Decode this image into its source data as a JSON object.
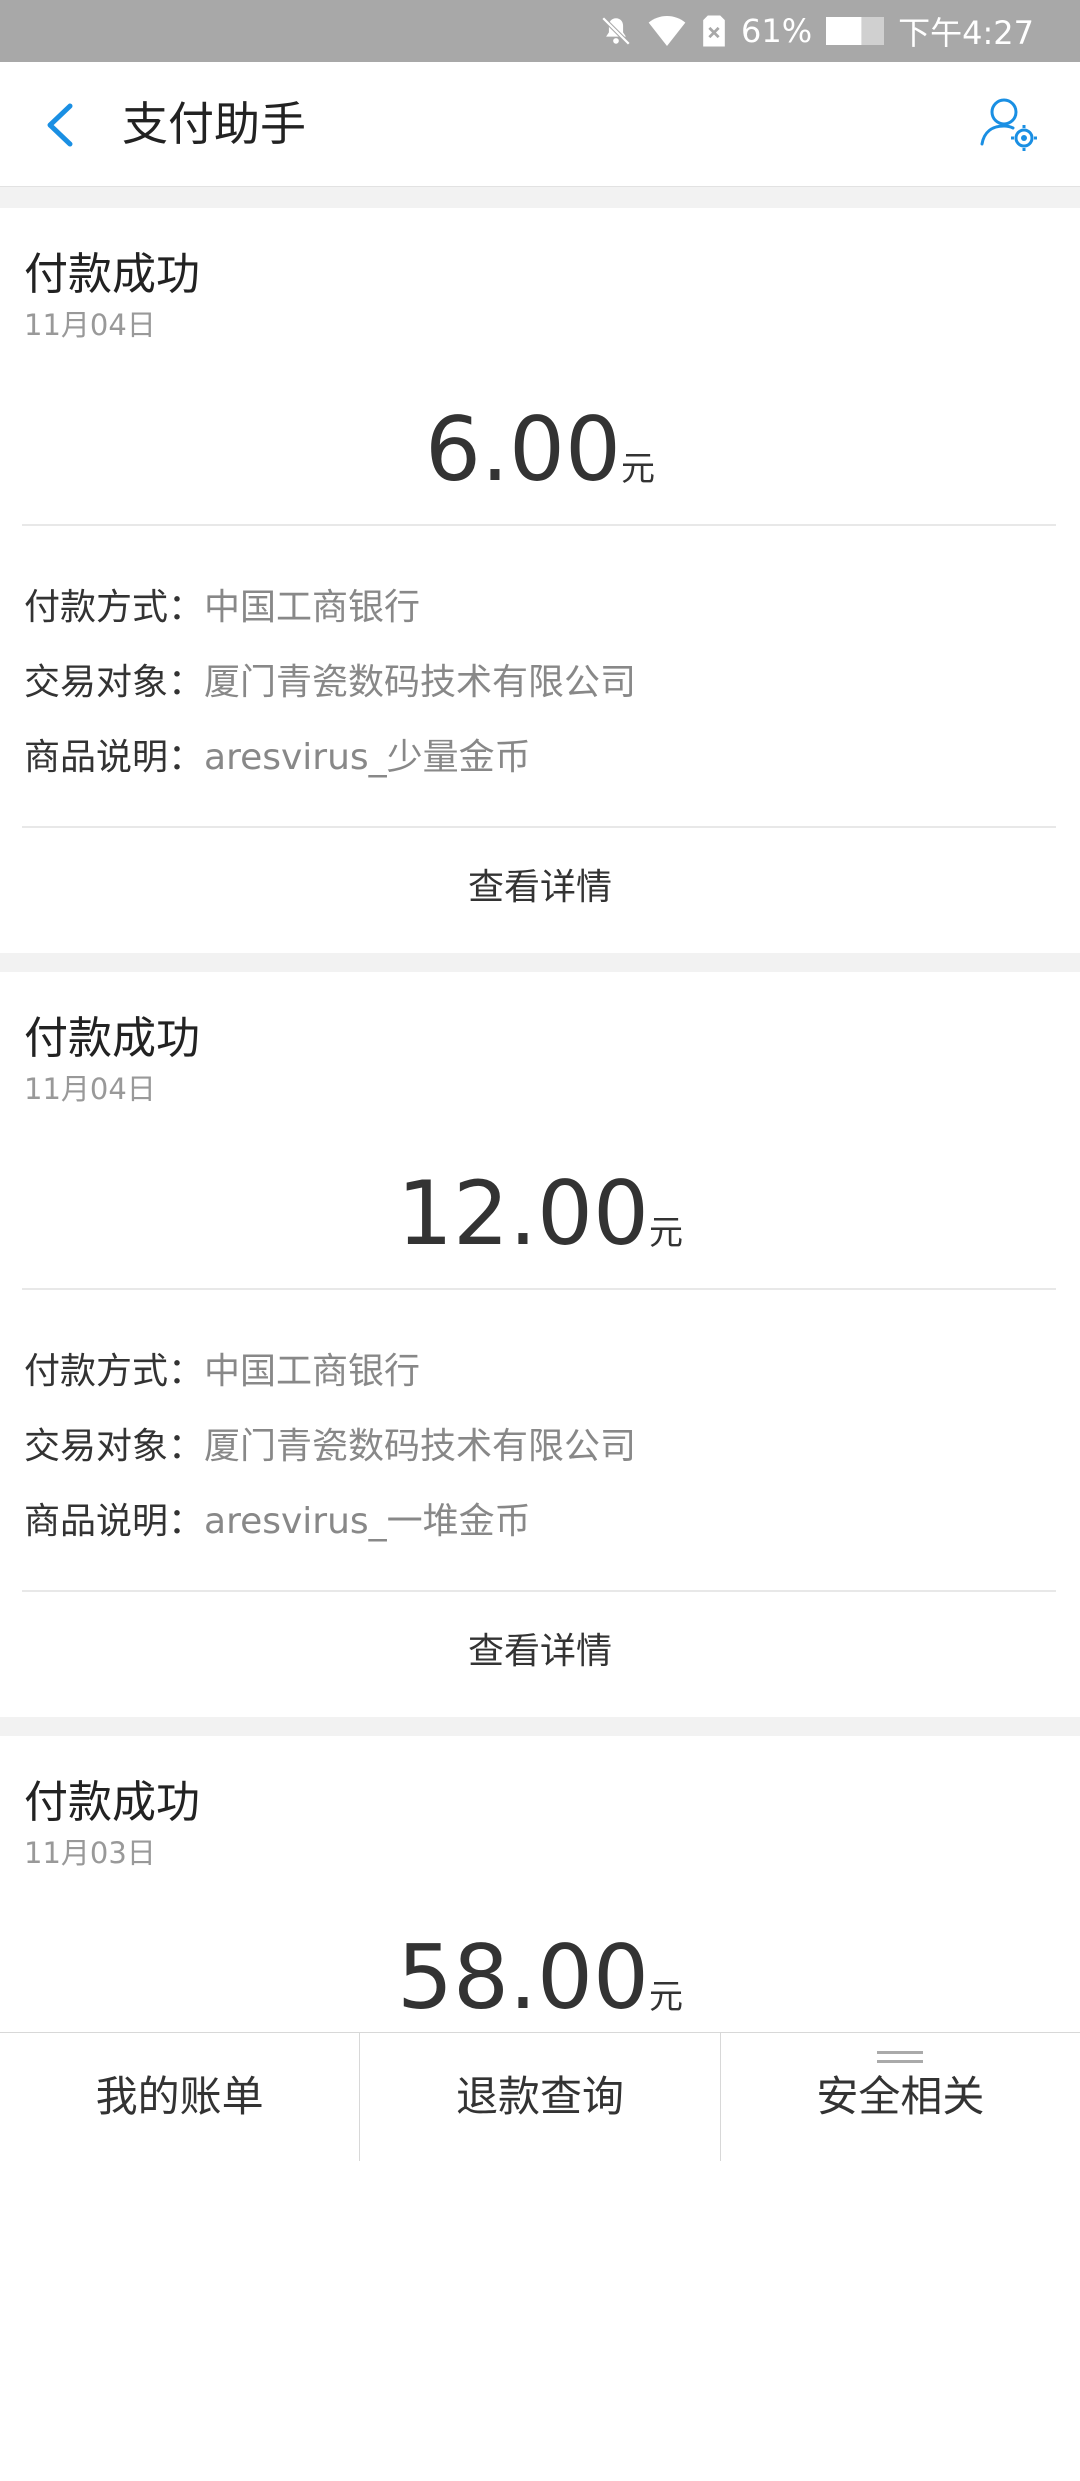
{
  "status_bar": {
    "battery_percent": "61%",
    "battery_level": 0.61,
    "time": "下午4:27"
  },
  "header": {
    "title": "支付助手"
  },
  "colors": {
    "accent": "#1a8fe3",
    "status_bar_bg": "#a8a8a8"
  },
  "cards": [
    {
      "status": "付款成功",
      "date": "11月04日",
      "amount": "6.00",
      "unit": "元",
      "payment_label": "付款方式：",
      "payment_value": "中国工商银行",
      "counterparty_label": "交易对象：",
      "counterparty_value": "厦门青瓷数码技术有限公司",
      "product_label": "商品说明：",
      "product_value": "aresvirus_少量金币",
      "detail_label": "查看详情"
    },
    {
      "status": "付款成功",
      "date": "11月04日",
      "amount": "12.00",
      "unit": "元",
      "payment_label": "付款方式：",
      "payment_value": "中国工商银行",
      "counterparty_label": "交易对象：",
      "counterparty_value": "厦门青瓷数码技术有限公司",
      "product_label": "商品说明：",
      "product_value": "aresvirus_一堆金币",
      "detail_label": "查看详情"
    },
    {
      "status": "付款成功",
      "date": "11月03日",
      "amount": "58.00",
      "unit": "元"
    }
  ],
  "tab_bar": {
    "tabs": [
      {
        "label": "我的账单"
      },
      {
        "label": "退款查询"
      },
      {
        "label": "安全相关"
      }
    ]
  },
  "icons": [
    "mute-bell-icon",
    "wifi-icon",
    "no-sim-icon",
    "battery-icon",
    "back-arrow-icon",
    "user-settings-icon",
    "menu-lines-icon"
  ]
}
